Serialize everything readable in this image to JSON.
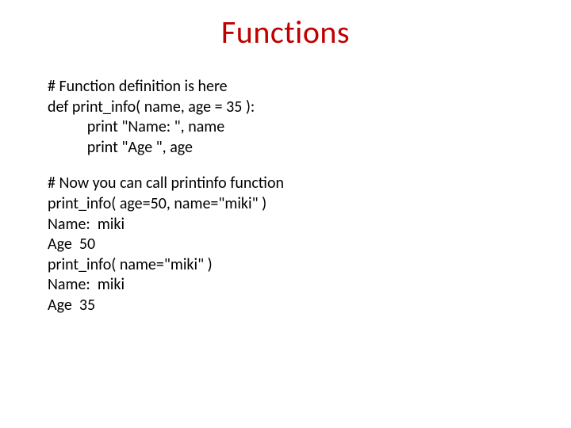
{
  "title": "Functions",
  "code1": {
    "l1": "# Function definition is here",
    "l2": "def print_info( name, age = 35 ):",
    "l3": "           print \"Name: \", name",
    "l4": "           print \"Age \", age"
  },
  "code2": {
    "l1": "# Now you can call printinfo function",
    "l2": "print_info( age=50, name=\"miki\" )",
    "l3": "Name:  miki",
    "l4": "Age  50",
    "l5": "print_info( name=\"miki\" )",
    "l6": "Name:  miki",
    "l7": "Age  35"
  }
}
